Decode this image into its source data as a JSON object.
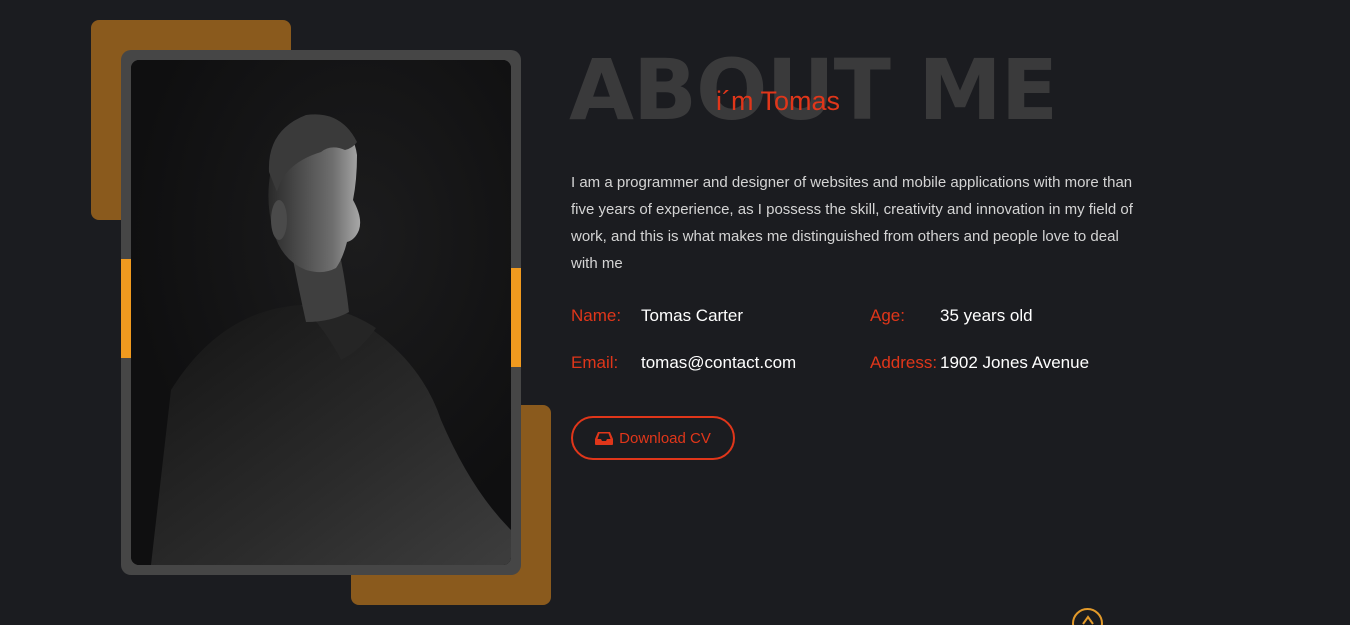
{
  "about": {
    "bg_title": "ABOUT ME",
    "sub_title": "i´m Tomas",
    "bio": "I am a programmer and designer of websites and mobile applications with more than five years of experience, as I possess the skill, creativity and innovation in my field of work, and this is what makes me distinguished from others and people love to deal with me"
  },
  "info": {
    "name_label": "Name:",
    "name_value": "Tomas Carter",
    "age_label": "Age:",
    "age_value": "35 years old",
    "email_label": "Email:",
    "email_value": "tomas@contact.com",
    "address_label": "Address:",
    "address_value": "1902 Jones Avenue"
  },
  "cv_button": {
    "label": "Download CV",
    "icon": "inbox-icon"
  },
  "scroll_button": {
    "icon": "arrow-up-icon"
  },
  "colors": {
    "background": "#1b1c20",
    "accent_red": "#e0361a",
    "accent_orange": "#f09a1f",
    "decor_brown": "#8a5a1d",
    "frame_gray": "#464646"
  }
}
